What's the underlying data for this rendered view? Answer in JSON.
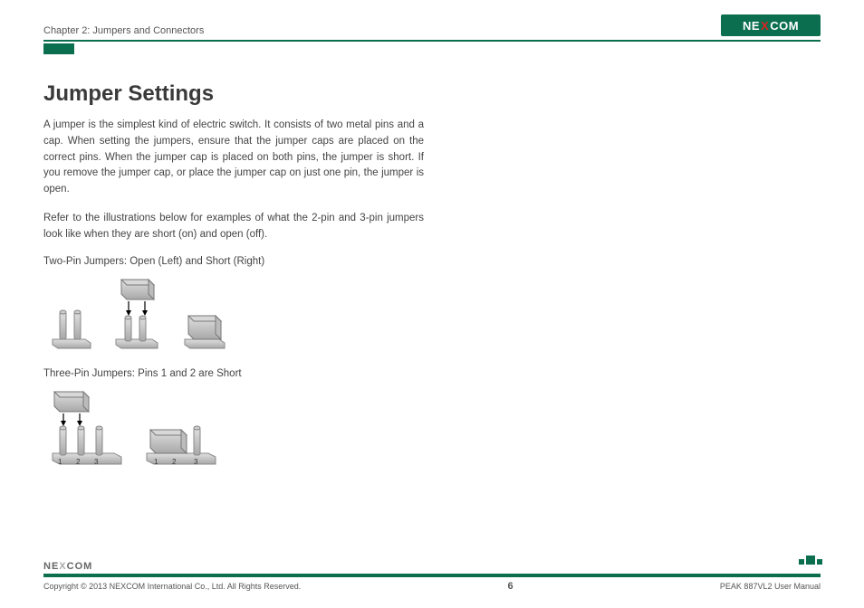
{
  "header": {
    "chapter": "Chapter 2: Jumpers and Connectors",
    "logo_text_1": "NE",
    "logo_text_x": "X",
    "logo_text_2": "COM"
  },
  "content": {
    "heading": "Jumper Settings",
    "para1": "A jumper is the simplest kind of electric switch. It consists of two metal pins and a cap. When setting the jumpers, ensure that the jumper caps are placed on the correct pins. When the jumper cap is placed on both pins, the jumper is short. If you remove the jumper cap, or place the jumper cap on just one pin, the jumper is open.",
    "para2": "Refer to the illustrations below for examples of what the 2-pin and 3-pin jumpers look like when they are short (on) and open (off).",
    "caption_two_pin": "Two-Pin Jumpers: Open (Left) and Short (Right)",
    "caption_three_pin": "Three-Pin Jumpers: Pins 1 and 2 are Short",
    "pin_labels": {
      "p1": "1",
      "p2": "2",
      "p3": "3"
    }
  },
  "footer": {
    "copyright": "Copyright © 2013 NEXCOM International Co., Ltd. All Rights Reserved.",
    "page": "6",
    "manual": "PEAK 887VL2 User Manual",
    "logo_text_1": "NE",
    "logo_text_x": "X",
    "logo_text_2": "COM"
  }
}
